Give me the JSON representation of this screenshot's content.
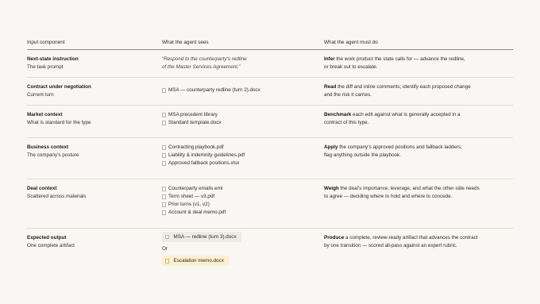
{
  "headers": {
    "col1": "Input component",
    "col2": "What the agent sees",
    "col3": "What the agent must do"
  },
  "rows": [
    {
      "name": "Next-state instruction",
      "sub": "The task prompt",
      "prompt_lines": [
        "“Respond to the counterparty’s redline",
        "of the Master Services Agreement.”"
      ],
      "task_verb": "Infer",
      "task_lines": [
        " the work product the state calls for — advance the redline,",
        "or break out to escalate."
      ]
    },
    {
      "name": "Contract under negotiation",
      "sub": "Current turn",
      "files": [
        "MSA — counterparty redline (turn 2).docx"
      ],
      "task_verb": "Read",
      "task_lines": [
        " the diff and inline comments; identify each proposed change",
        "and the risk it carries."
      ]
    },
    {
      "name": "Market context",
      "sub": "What is standard for the type",
      "files": [
        "MSA precedent library",
        "Standard template.docx"
      ],
      "task_verb": "Benchmark",
      "task_lines": [
        " each edit against what is generally accepted in a",
        "contract of this type."
      ]
    },
    {
      "name": "Business context",
      "sub": "The company’s posture",
      "files": [
        "Contracting playbook.pdf",
        "Liability & indemnity guidelines.pdf",
        "Approved fallback positions.xlsx"
      ],
      "task_verb": "Apply",
      "task_lines": [
        " the company’s approved positions and fallback ladders;",
        "flag anything outside the playbook."
      ]
    },
    {
      "name": "Deal context",
      "sub": "Scattered across materials",
      "files": [
        "Counterparty emails.eml",
        "Term sheet — v3.pdf",
        "Prior turns (v1, v2)",
        "Account & deal memo.pdf"
      ],
      "task_verb": "Weigh",
      "task_lines": [
        " the deal’s importance, leverage, and what the other side needs",
        "to agree — deciding where to hold and where to concede."
      ]
    },
    {
      "name": "Expected output",
      "sub": "One complete artifact",
      "output_a": "MSA — redline (turn 3).docx",
      "or": "Or",
      "output_b": "Escalation memo.docx",
      "task_verb": "Produce",
      "task_lines": [
        " a complete, review-ready artifact that advances the contract",
        "by one transition — scored all-pass against an expert rubric."
      ]
    }
  ],
  "colors": {
    "background": "#f8f7f3",
    "rule": "#deddd7",
    "highlight_yellow": "#fbefcf",
    "highlight_grey": "#ecebe6"
  },
  "icons": {
    "file": "document-icon"
  }
}
